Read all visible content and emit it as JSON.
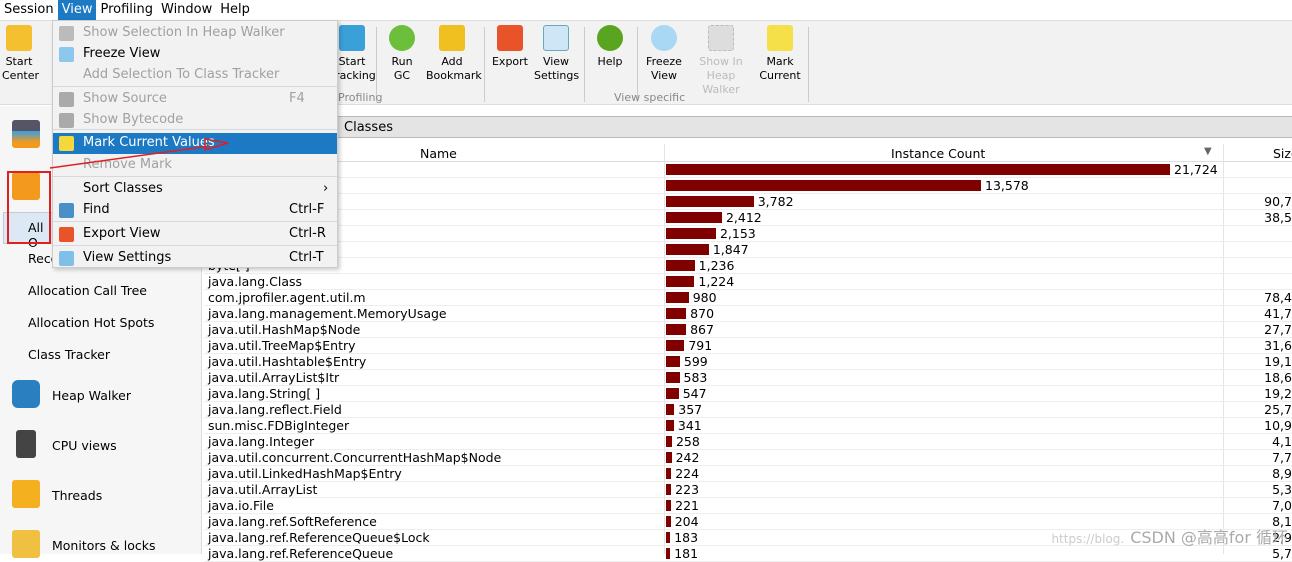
{
  "menubar": [
    "Session",
    "View",
    "Profiling",
    "Window",
    "Help"
  ],
  "toolbar": {
    "start_center": "Start Center",
    "start_tracking": "Start Tracking",
    "run_gc": "Run GC",
    "add_bookmark": "Add Bookmark",
    "export": "Export",
    "view_settings": "View Settings",
    "help": "Help",
    "freeze_view": "Freeze View",
    "show_in_heap_walker": "Show In Heap Walker",
    "mark_current": "Mark Current",
    "group_profiling": "Profiling",
    "group_view_specific": "View specific"
  },
  "view_menu": [
    {
      "label": "Show Selection In Heap Walker",
      "enabled": false,
      "icon": "camera-icon"
    },
    {
      "label": "Freeze View",
      "enabled": true,
      "icon": "snowflake-icon"
    },
    {
      "label": "Add Selection To Class Tracker",
      "enabled": false
    },
    {
      "label": "Show Source",
      "shortcut": "F4",
      "enabled": false,
      "icon": "source-icon"
    },
    {
      "label": "Show Bytecode",
      "enabled": false,
      "icon": "bytecode-icon"
    },
    {
      "label": "Mark Current Values",
      "enabled": true,
      "highlighted": true,
      "icon": "sticky-note-icon"
    },
    {
      "label": "Remove Mark",
      "enabled": false
    },
    {
      "label": "Sort Classes",
      "enabled": true,
      "submenu": "›"
    },
    {
      "label": "Find",
      "shortcut": "Ctrl-F",
      "enabled": true,
      "icon": "magnifier-icon"
    },
    {
      "label": "Export View",
      "shortcut": "Ctrl-R",
      "enabled": true,
      "icon": "export-icon"
    },
    {
      "label": "View Settings",
      "shortcut": "Ctrl-T",
      "enabled": true,
      "icon": "view-settings-icon"
    }
  ],
  "sidebar": {
    "all_objects": "All O",
    "recorded": "Reco",
    "items": [
      "Allocation Call Tree",
      "Allocation Hot Spots",
      "Class Tracker"
    ],
    "sections": [
      "Heap Walker",
      "CPU views",
      "Threads",
      "Monitors & locks"
    ]
  },
  "view_title": "Classes",
  "table": {
    "columns": [
      "Name",
      "Instance Count",
      "Size"
    ],
    "max_count": 21724,
    "rows": [
      {
        "name": "",
        "count": 21724,
        "count_label": "21,724",
        "size": ""
      },
      {
        "name": "",
        "count": 13578,
        "count_label": "13,578",
        "size": ""
      },
      {
        "name": "",
        "count": 3782,
        "count_label": "3,782",
        "size": "90,7"
      },
      {
        "name": "",
        "count": 2412,
        "count_label": "2,412",
        "size": "38,5"
      },
      {
        "name": "",
        "count": 2153,
        "count_label": "2,153",
        "size": ""
      },
      {
        "name": "",
        "count": 1847,
        "count_label": "1,847",
        "size": ""
      },
      {
        "name": "byte[ ]",
        "count": 1236,
        "count_label": "1,236",
        "size": ""
      },
      {
        "name": "java.lang.Class",
        "count": 1224,
        "count_label": "1,224",
        "size": ""
      },
      {
        "name": "com.jprofiler.agent.util.m",
        "count": 980,
        "count_label": "980",
        "size": "78,4"
      },
      {
        "name": "java.lang.management.MemoryUsage",
        "count": 870,
        "count_label": "870",
        "size": "41,7"
      },
      {
        "name": "java.util.HashMap$Node",
        "count": 867,
        "count_label": "867",
        "size": "27,7"
      },
      {
        "name": "java.util.TreeMap$Entry",
        "count": 791,
        "count_label": "791",
        "size": "31,6"
      },
      {
        "name": "java.util.Hashtable$Entry",
        "count": 599,
        "count_label": "599",
        "size": "19,1"
      },
      {
        "name": "java.util.ArrayList$Itr",
        "count": 583,
        "count_label": "583",
        "size": "18,6"
      },
      {
        "name": "java.lang.String[ ]",
        "count": 547,
        "count_label": "547",
        "size": "19,2"
      },
      {
        "name": "java.lang.reflect.Field",
        "count": 357,
        "count_label": "357",
        "size": "25,7"
      },
      {
        "name": "sun.misc.FDBigInteger",
        "count": 341,
        "count_label": "341",
        "size": "10,9"
      },
      {
        "name": "java.lang.Integer",
        "count": 258,
        "count_label": "258",
        "size": "4,1"
      },
      {
        "name": "java.util.concurrent.ConcurrentHashMap$Node",
        "count": 242,
        "count_label": "242",
        "size": "7,7"
      },
      {
        "name": "java.util.LinkedHashMap$Entry",
        "count": 224,
        "count_label": "224",
        "size": "8,9"
      },
      {
        "name": "java.util.ArrayList",
        "count": 223,
        "count_label": "223",
        "size": "5,3"
      },
      {
        "name": "java.io.File",
        "count": 221,
        "count_label": "221",
        "size": "7,0"
      },
      {
        "name": "java.lang.ref.SoftReference",
        "count": 204,
        "count_label": "204",
        "size": "8,1"
      },
      {
        "name": "java.lang.ref.ReferenceQueue$Lock",
        "count": 183,
        "count_label": "183",
        "size": "2,9"
      },
      {
        "name": "java.lang.ref.ReferenceQueue",
        "count": 181,
        "count_label": "181",
        "size": "5,7"
      }
    ]
  },
  "watermark": {
    "url": "https://blog.",
    "text": "CSDN @高高for 循环"
  },
  "colors": {
    "bar": "#800000",
    "highlight": "#1c79c3",
    "annotation": "#e02020"
  }
}
